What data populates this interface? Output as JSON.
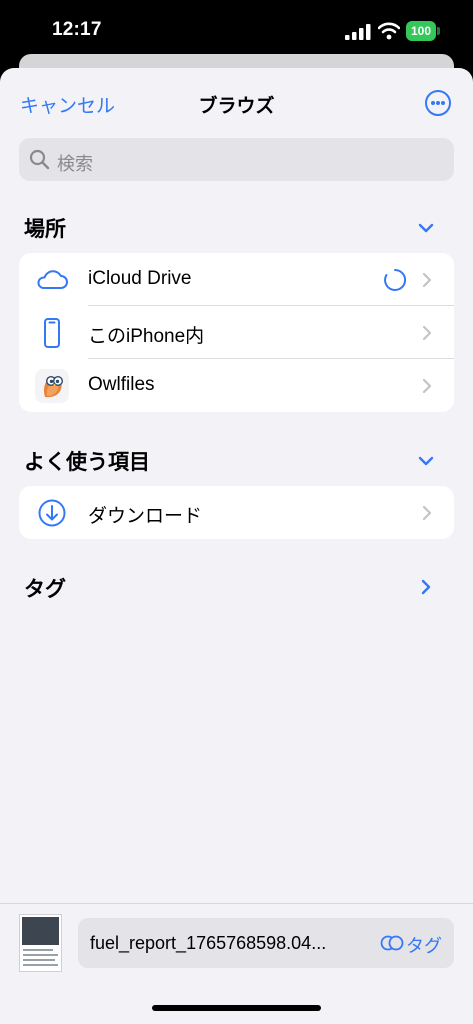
{
  "status_bar": {
    "time": "12:17",
    "battery": "100"
  },
  "nav": {
    "cancel": "キャンセル",
    "title": "ブラウズ"
  },
  "search": {
    "placeholder": "検索"
  },
  "sections": {
    "locations": {
      "title": "場所"
    },
    "favorites": {
      "title": "よく使う項目"
    },
    "tags": {
      "title": "タグ"
    }
  },
  "locations": [
    {
      "label": "iCloud Drive",
      "icon": "icloud-icon"
    },
    {
      "label": "このiPhone内",
      "icon": "iphone-icon"
    },
    {
      "label": "Owlfiles",
      "icon": "owlfiles-icon"
    }
  ],
  "favorites": [
    {
      "label": "ダウンロード",
      "icon": "download-icon"
    }
  ],
  "bottom": {
    "file_name": "fuel_report_1765768598.04...",
    "tag_label": "タグ"
  },
  "colors": {
    "accent": "#3478f6",
    "background": "#f2f2f7",
    "battery": "#34c759"
  }
}
